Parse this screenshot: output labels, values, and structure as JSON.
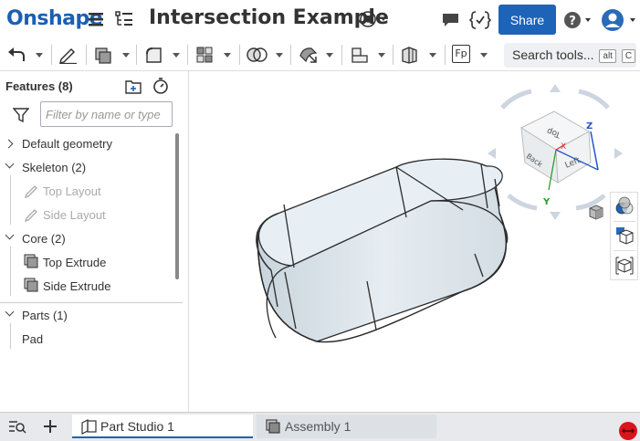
{
  "header": {
    "logo": "Onshape",
    "title": "Intersection Example",
    "share_label": "Share"
  },
  "toolbar": {
    "search_label": "Search tools...",
    "search_shortcut_1": "alt",
    "search_shortcut_2": "C",
    "fp_label": "Fp"
  },
  "feature_panel": {
    "title": "Features (8)",
    "filter_placeholder": "Filter by name or type",
    "items": [
      {
        "label": "Default geometry",
        "type": "group",
        "expanded": false
      },
      {
        "label": "Skeleton (2)",
        "type": "group",
        "expanded": true
      },
      {
        "label": "Top Layout",
        "type": "sketch",
        "suppressed": true
      },
      {
        "label": "Side Layout",
        "type": "sketch",
        "suppressed": true
      },
      {
        "label": "Core (2)",
        "type": "group",
        "expanded": true
      },
      {
        "label": "Top Extrude",
        "type": "extrude"
      },
      {
        "label": "Side Extrude",
        "type": "extrude"
      }
    ],
    "parts_title": "Parts (1)",
    "parts": [
      {
        "label": "Pad"
      }
    ]
  },
  "view_cube": {
    "faces": [
      "Top",
      "Left",
      "Back"
    ],
    "axes": [
      "X",
      "Y",
      "Z"
    ]
  },
  "tabs": [
    {
      "label": "Part Studio 1",
      "active": true
    },
    {
      "label": "Assembly 1",
      "active": false
    }
  ],
  "colors": {
    "brand": "#1a5fb4",
    "share_bg": "#1d63b8",
    "part_fill": "#dce6ee",
    "part_edge": "#2b2b2b"
  }
}
